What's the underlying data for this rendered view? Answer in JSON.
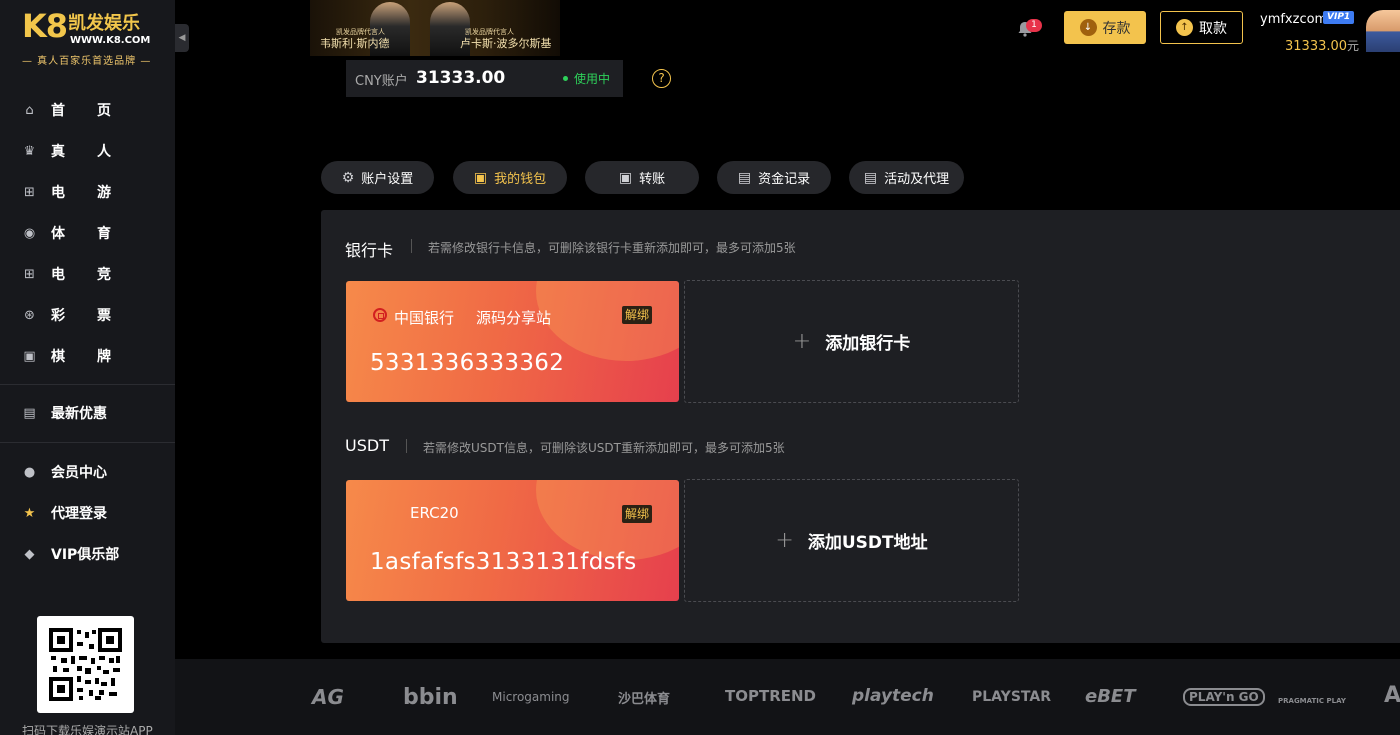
{
  "logo": {
    "mark": "K8",
    "brand": "凯发娱乐",
    "url": "WWW.K8.COM",
    "slogan": "— 真人百家乐首选品牌 —"
  },
  "sidebar": {
    "items": [
      {
        "label_a": "首",
        "label_b": "页",
        "icon": "home-icon"
      },
      {
        "label_a": "真",
        "label_b": "人",
        "icon": "live-icon"
      },
      {
        "label_a": "电",
        "label_b": "游",
        "icon": "gamepad-icon"
      },
      {
        "label_a": "体",
        "label_b": "育",
        "icon": "ball-icon"
      },
      {
        "label_a": "电",
        "label_b": "竞",
        "icon": "controller-icon"
      },
      {
        "label_a": "彩",
        "label_b": "票",
        "icon": "lottery-icon"
      },
      {
        "label_a": "棋",
        "label_b": "牌",
        "icon": "cards-icon"
      }
    ],
    "promo": {
      "label": "最新优惠",
      "icon": "gift-icon"
    },
    "member": {
      "label": "会员中心",
      "icon": "user-icon"
    },
    "agent": {
      "label": "代理登录",
      "icon": "star-icon"
    },
    "vip": {
      "label": "VIP俱乐部",
      "icon": "diamond-icon"
    },
    "qr_caption": "扫码下载乐娱演示站APP"
  },
  "banner": {
    "tag1": "凯发品牌代言人",
    "name1": "韦斯利·斯内德",
    "tag2": "凯发品牌代言人",
    "name2": "卢卡斯·波多尔斯基"
  },
  "header": {
    "notification_count": "1",
    "deposit_label": "存款",
    "withdraw_label": "取款",
    "username": "ymfxzcom",
    "vip_badge": "VIP1",
    "balance": "31333.00",
    "balance_unit": "元"
  },
  "account": {
    "label": "CNY账户",
    "amount": "31333.00",
    "status": "使用中",
    "help": "?"
  },
  "tabs": [
    {
      "label": "账户设置",
      "icon": "gear-icon"
    },
    {
      "label": "我的钱包",
      "icon": "wallet-icon",
      "active": true
    },
    {
      "label": "转账",
      "icon": "transfer-icon"
    },
    {
      "label": "资金记录",
      "icon": "record-icon"
    },
    {
      "label": "活动及代理",
      "icon": "activity-icon"
    }
  ],
  "bank_section": {
    "title": "银行卡",
    "hint": "若需修改银行卡信息，可删除该银行卡重新添加即可，最多可添加5张",
    "card": {
      "bank": "中国银行",
      "holder": "源码分享站",
      "unbind": "解绑",
      "number": "5331336333362"
    },
    "add_label": "添加银行卡"
  },
  "usdt_section": {
    "title": "USDT",
    "hint": "若需修改USDT信息，可删除该USDT重新添加即可，最多可添加5张",
    "card": {
      "chain": "ERC20",
      "unbind": "解绑",
      "address": "1asfafsfs3133131fdsfs"
    },
    "add_label": "添加USDT地址"
  },
  "partners": [
    "AG",
    "bbin",
    "Microgaming",
    "沙巴体育",
    "TOPTREND",
    "playtech",
    "PLAYSTAR",
    "eBET",
    "PLAY'n GO",
    "PRAGMATIC PLAY",
    "AE"
  ],
  "colors": {
    "accent": "#f3c34d",
    "panel": "#1e1f23",
    "sidebar": "#17181c",
    "status": "#2ed15a"
  }
}
